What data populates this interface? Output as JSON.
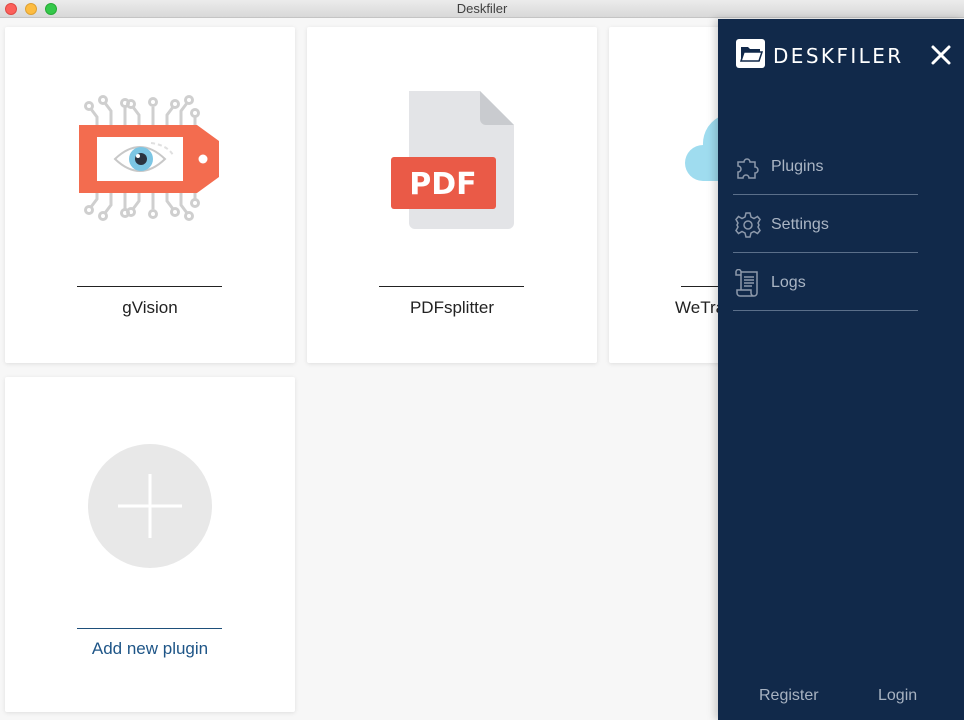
{
  "window": {
    "title": "Deskfiler"
  },
  "plugins": [
    {
      "name": "gVision",
      "icon": "gvision-eye-tag-icon"
    },
    {
      "name": "PDFsplitter",
      "icon": "pdf-file-icon",
      "badge": "PDF"
    },
    {
      "name": "WeTra",
      "icon": "cloud-icon"
    }
  ],
  "add_plugin": {
    "label": "Add new plugin",
    "icon": "plus-icon"
  },
  "sidebar": {
    "brand": "DESKFILER",
    "menu": [
      {
        "label": "Plugins",
        "icon": "puzzle-icon"
      },
      {
        "label": "Settings",
        "icon": "gear-icon"
      },
      {
        "label": "Logs",
        "icon": "scroll-icon"
      }
    ],
    "footer": {
      "register": "Register",
      "login": "Login"
    }
  },
  "colors": {
    "sidebar_bg": "#11294a",
    "accent_red": "#f36c4f",
    "pdf_red": "#ea5a47",
    "link_blue": "#1e5587"
  }
}
